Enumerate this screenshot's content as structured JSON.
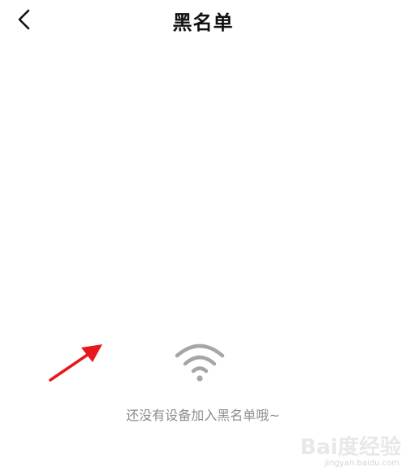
{
  "header": {
    "title": "黑名单",
    "back_icon": "chevron-left-icon"
  },
  "empty_state": {
    "icon": "wifi-icon",
    "message": "还没有设备加入黑名单哦~"
  },
  "annotation": {
    "icon": "red-arrow-icon",
    "color": "#e8161d"
  },
  "watermark": {
    "brand": "Bai度经验",
    "url": "jingyan.baidu.com"
  },
  "colors": {
    "background": "#ffffff",
    "title": "#111111",
    "message": "#8c8c8c",
    "icon": "#a6a6a6"
  }
}
